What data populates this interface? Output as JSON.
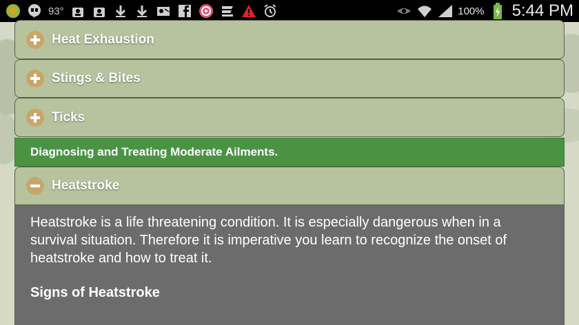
{
  "status_bar": {
    "temperature": "93°",
    "battery_percent": "100%",
    "time": "5:44 PM",
    "icons": [
      "coin-icon",
      "hangouts-icon",
      "weather-icon",
      "contacts-icon",
      "contacts-icon",
      "download-icon",
      "download-icon",
      "outlook-icon",
      "facebook-icon",
      "podcast-icon",
      "app-icon",
      "warning-icon",
      "alarm-icon",
      "eye-icon",
      "wifi-icon",
      "signal-icon",
      "battery-charging-icon"
    ]
  },
  "sections": [
    {
      "label": "Heat Exhaustion",
      "state": "collapsed"
    },
    {
      "label": "Stings & Bites",
      "state": "collapsed"
    },
    {
      "label": "Ticks",
      "state": "collapsed"
    }
  ],
  "category_banner": "Diagnosing and Treating Moderate Ailments.",
  "expanded_section": {
    "label": "Heatstroke",
    "state": "expanded",
    "body": "Heatstroke is a life threatening condition. It is especially dangerous when in a survival situation. Therefore it is imperative you learn to recognize the onset of heatstroke and how to treat it.",
    "subheading": "Signs of Heatstroke"
  },
  "colors": {
    "panel": "#b7c39e",
    "banner": "#4a9344",
    "content": "#6c6c6c",
    "toggle_circle": "#c8a66a"
  }
}
